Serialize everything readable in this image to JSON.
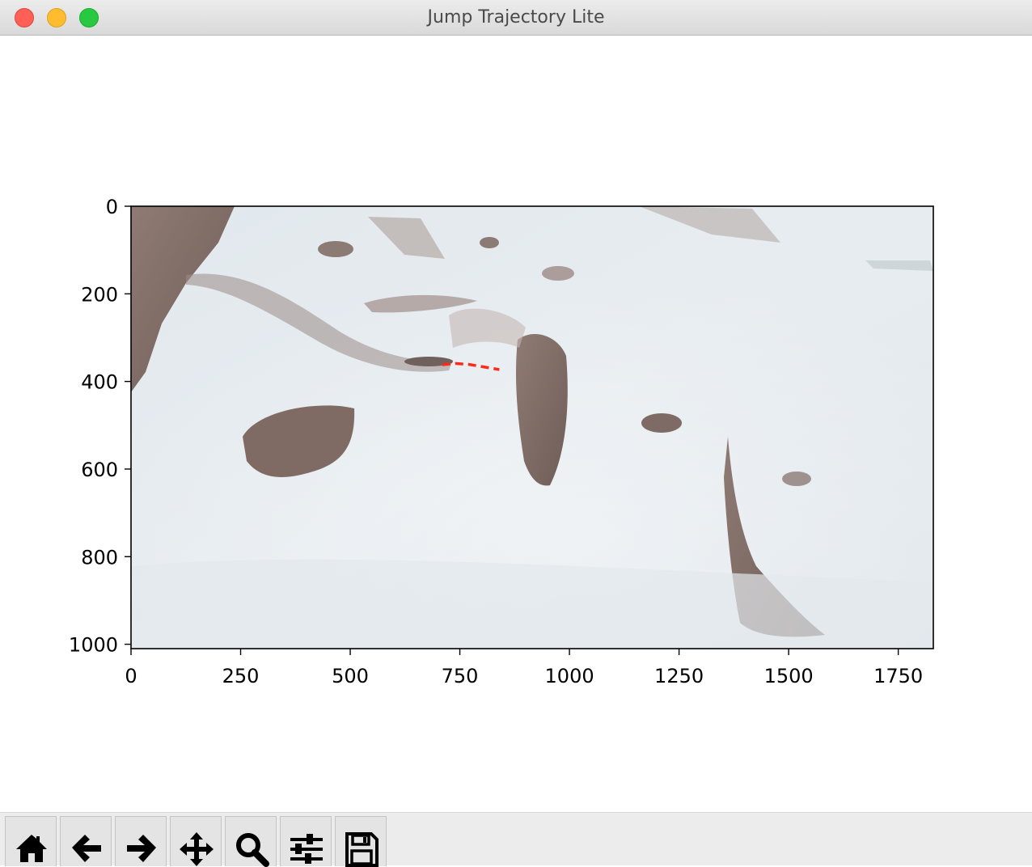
{
  "window": {
    "title": "Jump Trajectory Lite"
  },
  "plot": {
    "x_ticks": [
      "0",
      "250",
      "500",
      "750",
      "1000",
      "1250",
      "1500",
      "1750"
    ],
    "y_ticks": [
      "0",
      "200",
      "400",
      "600",
      "800",
      "1000"
    ],
    "xlim": [
      0,
      1830
    ],
    "ylim": [
      1010,
      0
    ],
    "image_extent": [
      0,
      1830,
      1010,
      0
    ],
    "trajectory_color": "#ff2a1a",
    "trajectory": [
      [
        710,
        362
      ],
      [
        740,
        359
      ],
      [
        770,
        361
      ],
      [
        800,
        366
      ],
      [
        840,
        373
      ]
    ]
  },
  "toolbar": {
    "buttons": [
      {
        "name": "home-button",
        "icon": "home-icon"
      },
      {
        "name": "back-button",
        "icon": "arrow-left-icon"
      },
      {
        "name": "forward-button",
        "icon": "arrow-right-icon"
      },
      {
        "name": "pan-button",
        "icon": "move-icon"
      },
      {
        "name": "zoom-button",
        "icon": "search-icon"
      },
      {
        "name": "configure-subplots-button",
        "icon": "sliders-icon"
      },
      {
        "name": "save-button",
        "icon": "floppy-disk-icon"
      }
    ]
  }
}
